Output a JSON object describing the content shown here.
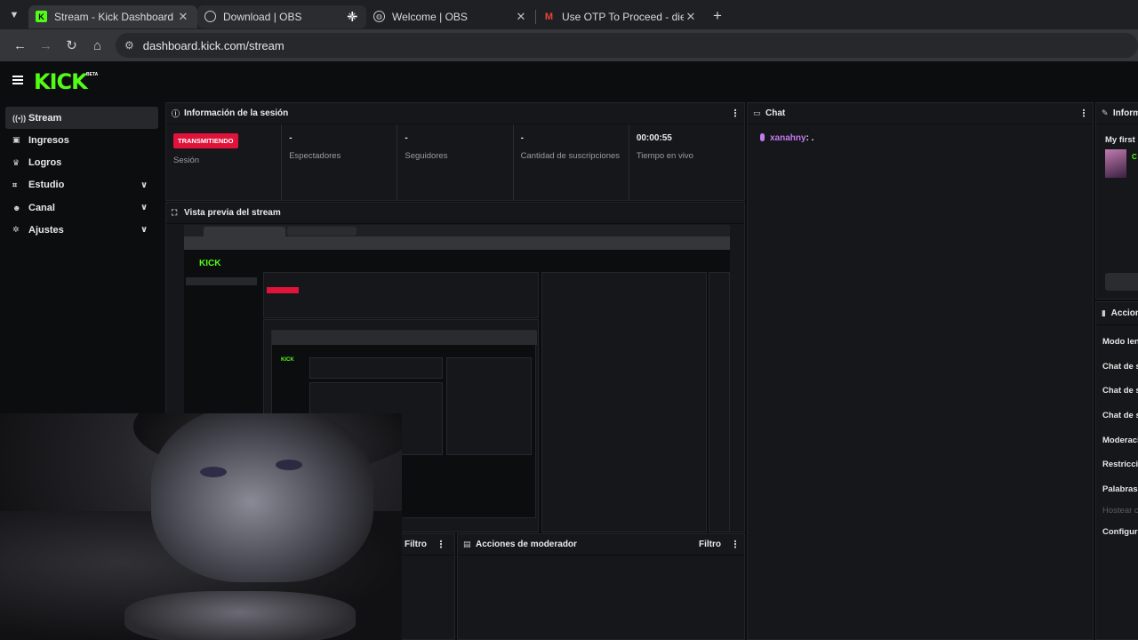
{
  "browser": {
    "tabs": [
      {
        "title": "Stream - Kick Dashboard",
        "favicon": "kick-icon",
        "active": true
      },
      {
        "title": "Download | OBS",
        "favicon": "obs-icon",
        "active": false
      },
      {
        "title": "Welcome | OBS",
        "favicon": "globe-icon",
        "active": false
      },
      {
        "title": "Use OTP To Proceed - diegobra",
        "favicon": "gmail-icon",
        "active": false
      }
    ],
    "url": "dashboard.kick.com/stream"
  },
  "app": {
    "logo": "KICK",
    "beta": "BETA",
    "brand_color": "#53fc18",
    "sidebar": [
      {
        "label": "Stream",
        "icon": "broadcast-icon",
        "active": true,
        "expandable": false
      },
      {
        "label": "Ingresos",
        "icon": "wallet-icon",
        "active": false,
        "expandable": false
      },
      {
        "label": "Logros",
        "icon": "trophy-icon",
        "active": false,
        "expandable": false
      },
      {
        "label": "Estudio",
        "icon": "studio-icon",
        "active": false,
        "expandable": true
      },
      {
        "label": "Canal",
        "icon": "people-icon",
        "active": false,
        "expandable": true
      },
      {
        "label": "Ajustes",
        "icon": "gear-icon",
        "active": false,
        "expandable": true
      }
    ],
    "session": {
      "title": "Información de la sesión",
      "badge": "TRANSMITIENDO",
      "badge_color": "#e0133b",
      "stats": [
        {
          "value": "",
          "label": "Sesión"
        },
        {
          "value": "-",
          "label": "Espectadores"
        },
        {
          "value": "-",
          "label": "Seguidores"
        },
        {
          "value": "-",
          "label": "Cantidad de suscripciones"
        },
        {
          "value": "00:00:55",
          "label": "Tiempo en vivo"
        }
      ]
    },
    "preview": {
      "title": "Vista previa del stream"
    },
    "chat": {
      "title": "Chat",
      "messages": [
        {
          "user": "xanahny",
          "text": ": ."
        }
      ],
      "user_color": "#c37bf0"
    },
    "left_panel": {
      "filter": "Filtro"
    },
    "mod_actions": {
      "title": "Acciones de moderador",
      "filter": "Filtro"
    },
    "info": {
      "title": "Inform",
      "stream_title": "My first",
      "initial": "C"
    },
    "actions": {
      "title": "Accion",
      "items": [
        "Modo len",
        "Chat de s",
        "Chat de s",
        "Chat de s",
        "Moderaci",
        "Restricci",
        "Palabras",
        "Hostear c",
        "Configura"
      ]
    }
  }
}
